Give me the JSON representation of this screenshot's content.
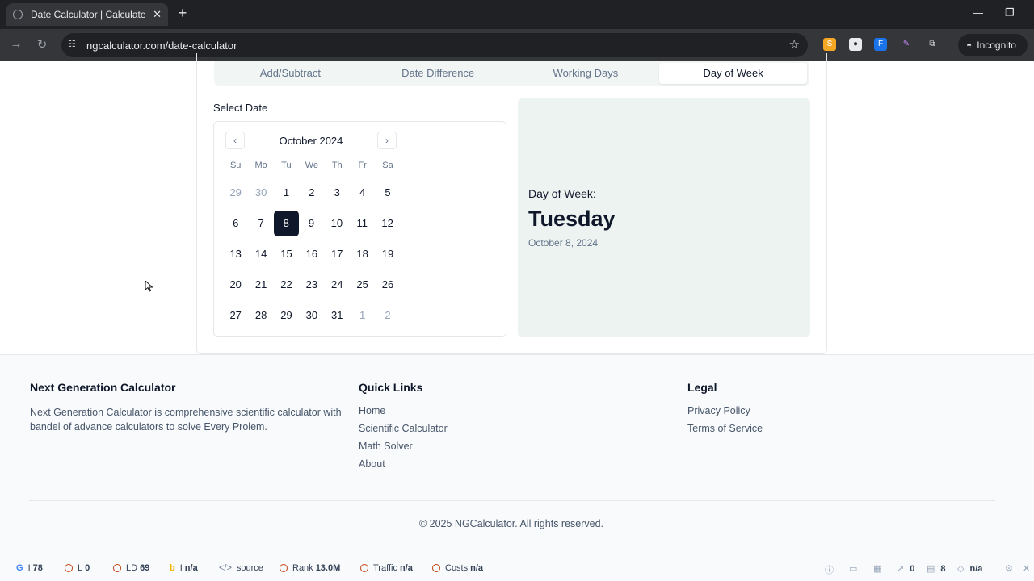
{
  "browser": {
    "tab_title": "Date Calculator | Calculate Days",
    "url": "ngcalculator.com/date-calculator",
    "incognito_label": "Incognito"
  },
  "tabs": [
    "Add/Subtract",
    "Date Difference",
    "Working Days",
    "Day of Week"
  ],
  "active_tab": "Day of Week",
  "calendar": {
    "select_label": "Select Date",
    "month_label": "October 2024",
    "weekday_headers": [
      "Su",
      "Mo",
      "Tu",
      "We",
      "Th",
      "Fr",
      "Sa"
    ],
    "weeks": [
      [
        "29",
        "30",
        "1",
        "2",
        "3",
        "4",
        "5"
      ],
      [
        "6",
        "7",
        "8",
        "9",
        "10",
        "11",
        "12"
      ],
      [
        "13",
        "14",
        "15",
        "16",
        "17",
        "18",
        "19"
      ],
      [
        "20",
        "21",
        "22",
        "23",
        "24",
        "25",
        "26"
      ],
      [
        "27",
        "28",
        "29",
        "30",
        "31",
        "1",
        "2"
      ]
    ],
    "selected_day": "8"
  },
  "result": {
    "label": "Day of Week:",
    "day": "Tuesday",
    "date": "October 8, 2024"
  },
  "footer": {
    "about_title": "Next Generation Calculator",
    "about_text": "Next Generation Calculator is comprehensive scientific calculator with bandel of advance calculators to solve Every Prolem.",
    "links_title": "Quick Links",
    "links": [
      "Home",
      "Scientific Calculator",
      "Math Solver",
      "About"
    ],
    "legal_title": "Legal",
    "legal_links": [
      "Privacy Policy",
      "Terms of Service"
    ],
    "copyright": "© 2025 NGCalculator. All rights reserved."
  },
  "statusbar": {
    "g_label": "I",
    "g_value": "78",
    "l_label": "L",
    "l_value": "0",
    "ld_label": "LD",
    "ld_value": "69",
    "b_label": "I",
    "b_value": "n/a",
    "source_label": "source",
    "rank_label": "Rank",
    "rank_value": "13.0M",
    "traffic_label": "Traffic",
    "traffic_value": "n/a",
    "costs_label": "Costs",
    "costs_value": "n/a",
    "links_out_value": "0",
    "pages_value": "8",
    "diamond_value": "n/a"
  }
}
